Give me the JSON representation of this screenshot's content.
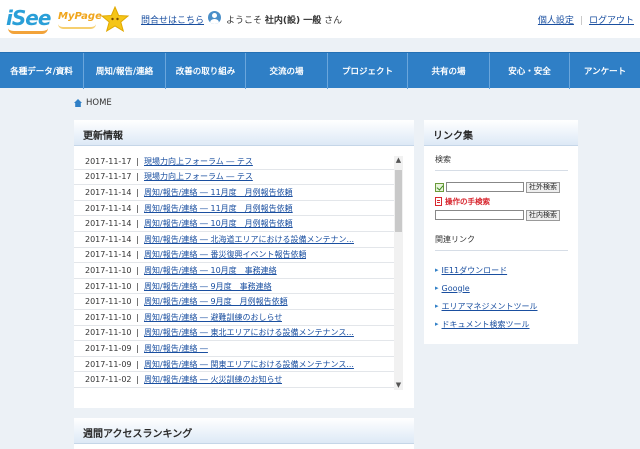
{
  "header": {
    "logo_text": "iSee",
    "mypage_logo_text": "MyPage",
    "inquiry_link": "問合せはこちら",
    "welcome_prefix": "ようこそ",
    "user_name": "社内(設) 一般",
    "welcome_suffix": "さん",
    "personal_settings": "個人設定",
    "logout": "ログアウト"
  },
  "nav": {
    "items": [
      {
        "label": "各種データ/資料"
      },
      {
        "label": "周知/報告/連絡"
      },
      {
        "label": "改善の取り組み"
      },
      {
        "label": "交流の場"
      },
      {
        "label": "プロジェクト"
      },
      {
        "label": "共有の場"
      },
      {
        "label": "安心・安全"
      },
      {
        "label": "アンケート"
      }
    ]
  },
  "breadcrumb": {
    "home": "HOME"
  },
  "news": {
    "heading": "更新情報",
    "separator": "|",
    "items": [
      {
        "date": "2017-11-17",
        "title": "現場力向上フォーラム ― テス"
      },
      {
        "date": "2017-11-17",
        "title": "現場力向上フォーラム ― テス"
      },
      {
        "date": "2017-11-14",
        "title": "周知/報告/連絡 ― 11月度　月例報告依頼"
      },
      {
        "date": "2017-11-14",
        "title": "周知/報告/連絡 ― 11月度　月例報告依頼"
      },
      {
        "date": "2017-11-14",
        "title": "周知/報告/連絡 ― 10月度　月例報告依頼"
      },
      {
        "date": "2017-11-14",
        "title": "周知/報告/連絡 ― 北海道エリアにおける設備メンテナン..."
      },
      {
        "date": "2017-11-14",
        "title": "周知/報告/連絡 ― 番災復興イベント報告依頼"
      },
      {
        "date": "2017-11-10",
        "title": "周知/報告/連絡 ― 10月度　事務連絡"
      },
      {
        "date": "2017-11-10",
        "title": "周知/報告/連絡 ― 9月度　事務連絡"
      },
      {
        "date": "2017-11-10",
        "title": "周知/報告/連絡 ― 9月度　月例報告依頼"
      },
      {
        "date": "2017-11-10",
        "title": "周知/報告/連絡 ― 避難訓練のおしらせ"
      },
      {
        "date": "2017-11-10",
        "title": "周知/報告/連絡 ― 東北エリアにおける設備メンテナンス..."
      },
      {
        "date": "2017-11-09",
        "title": "周知/報告/連絡 ―"
      },
      {
        "date": "2017-11-09",
        "title": "周知/報告/連絡 ― 関東エリアにおける設備メンテナンス..."
      },
      {
        "date": "2017-11-02",
        "title": "周知/報告/連絡 ― 火災訓練のお知らせ"
      }
    ]
  },
  "links": {
    "heading": "リンク集",
    "search_label": "検索",
    "external_search_button": "社外検索",
    "manual_text": "操作の手検索",
    "internal_search_button": "社内検索",
    "related_label": "関連リンク",
    "items": [
      {
        "label": "IE11ダウンロード"
      },
      {
        "label": "Google"
      },
      {
        "label": "エリアマネジメントツール"
      },
      {
        "label": "ドキュメント検索ツール"
      }
    ]
  },
  "ranking": {
    "heading": "週間アクセスランキング"
  },
  "colors": {
    "nav": "#2f7fc6",
    "link": "#1a4fa0",
    "background": "#ecf1f6",
    "accent_red": "#d8272f"
  }
}
